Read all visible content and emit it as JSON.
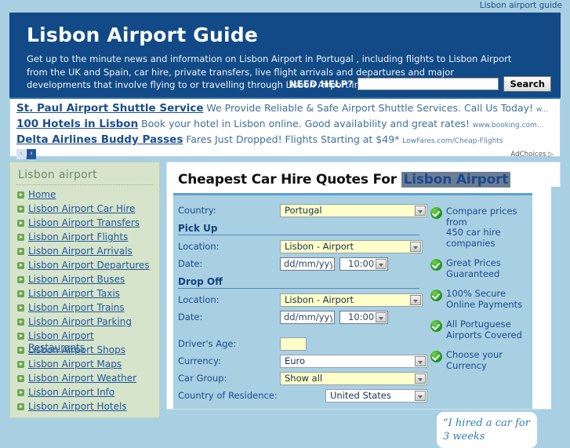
{
  "top": {
    "guide_link": "Lisbon airport guide"
  },
  "header": {
    "title": "Lisbon Airport Guide",
    "description": "Get up to the minute news and information on Lisbon Airport in Portugal , including flights to Lisbon Airport from the UK and Spain, car hire, private transfers, live flight arrivals and departures and major developments that involve flying to or travelling through Lisbon Airport in Portugal.",
    "need_help_label": "NEED HELP?",
    "search_value": "",
    "search_placeholder": "",
    "search_button": "Search",
    "banner_color": "#114a86"
  },
  "ads": {
    "items": [
      {
        "title": "St. Paul Airport Shuttle Service",
        "desc": "We Provide Reliable & Safe Airport Shuttle Services. Call Us Today!",
        "url": "w..."
      },
      {
        "title": "100 Hotels in Lisbon",
        "desc": "Book your hotel in Lisbon online. Good availability and great rates!",
        "url": "www.booking.com..."
      },
      {
        "title": "Delta Airlines Buddy Passes",
        "desc": "Fares Just Dropped! Flights Starting at $49*",
        "url": "LowFares.com/Cheap-Flights"
      }
    ],
    "prev_arrow": "‹",
    "next_arrow": "›",
    "adchoices": "AdChoices ▷"
  },
  "sidebar": {
    "title": "Lisbon airport",
    "items": [
      {
        "label": "Home"
      },
      {
        "label": "Lisbon Airport Car Hire"
      },
      {
        "label": "Lisbon Airport Transfers"
      },
      {
        "label": "Lisbon Airport Flights"
      },
      {
        "label": "Lisbon Airport Arrivals"
      },
      {
        "label": "Lisbon Airport Departures"
      },
      {
        "label": "Lisbon Airport Buses"
      },
      {
        "label": "Lisbon Airport Taxis"
      },
      {
        "label": "Lisbon Airport Trains"
      },
      {
        "label": "Lisbon Airport Parking"
      },
      {
        "label": "Lisbon Airport Restaurants"
      },
      {
        "label": "Lisbon Airport Shops"
      },
      {
        "label": "Lisbon Airport Maps"
      },
      {
        "label": "Lisbon Airport Weather"
      },
      {
        "label": "Lisbon Airport Info"
      },
      {
        "label": "Lisbon Airport Hotels"
      }
    ]
  },
  "widget": {
    "heading_plain": "Cheapest Car Hire Quotes For ",
    "heading_highlight": "Lisbon Airport",
    "highlight_bg": "#6b7d92",
    "country_label": "Country:",
    "country_value": "Portugal",
    "pickup_heading": "Pick Up",
    "pickup_location_label": "Location:",
    "pickup_location_value": "Lisbon - Airport",
    "pickup_date_label": "Date:",
    "pickup_date_value": "dd/mm/yyyy",
    "pickup_time_value": "10:00",
    "dropoff_heading": "Drop Off",
    "dropoff_location_label": "Location:",
    "dropoff_location_value": "Lisbon - Airport",
    "dropoff_date_label": "Date:",
    "dropoff_date_value": "dd/mm/yyyy",
    "dropoff_time_value": "10:00",
    "age_label": "Driver's Age:",
    "age_value": "",
    "currency_label": "Currency:",
    "currency_value": "Euro",
    "cargroup_label": "Car Group:",
    "cargroup_value": "Show all",
    "residence_label": "Country of Residence:",
    "residence_value": "United States",
    "benefits": [
      {
        "line1": "Compare prices from",
        "line2": "450 car hire companies"
      },
      {
        "line1": "Great Prices",
        "line2": "Guaranteed"
      },
      {
        "line1": "100% Secure",
        "line2": "Online Payments"
      },
      {
        "line1": "All Portuguese",
        "line2": "Airports Covered"
      },
      {
        "line1": "Choose your",
        "line2": "Currency"
      }
    ],
    "testimonial": "“I hired a car for 3 weeks"
  }
}
